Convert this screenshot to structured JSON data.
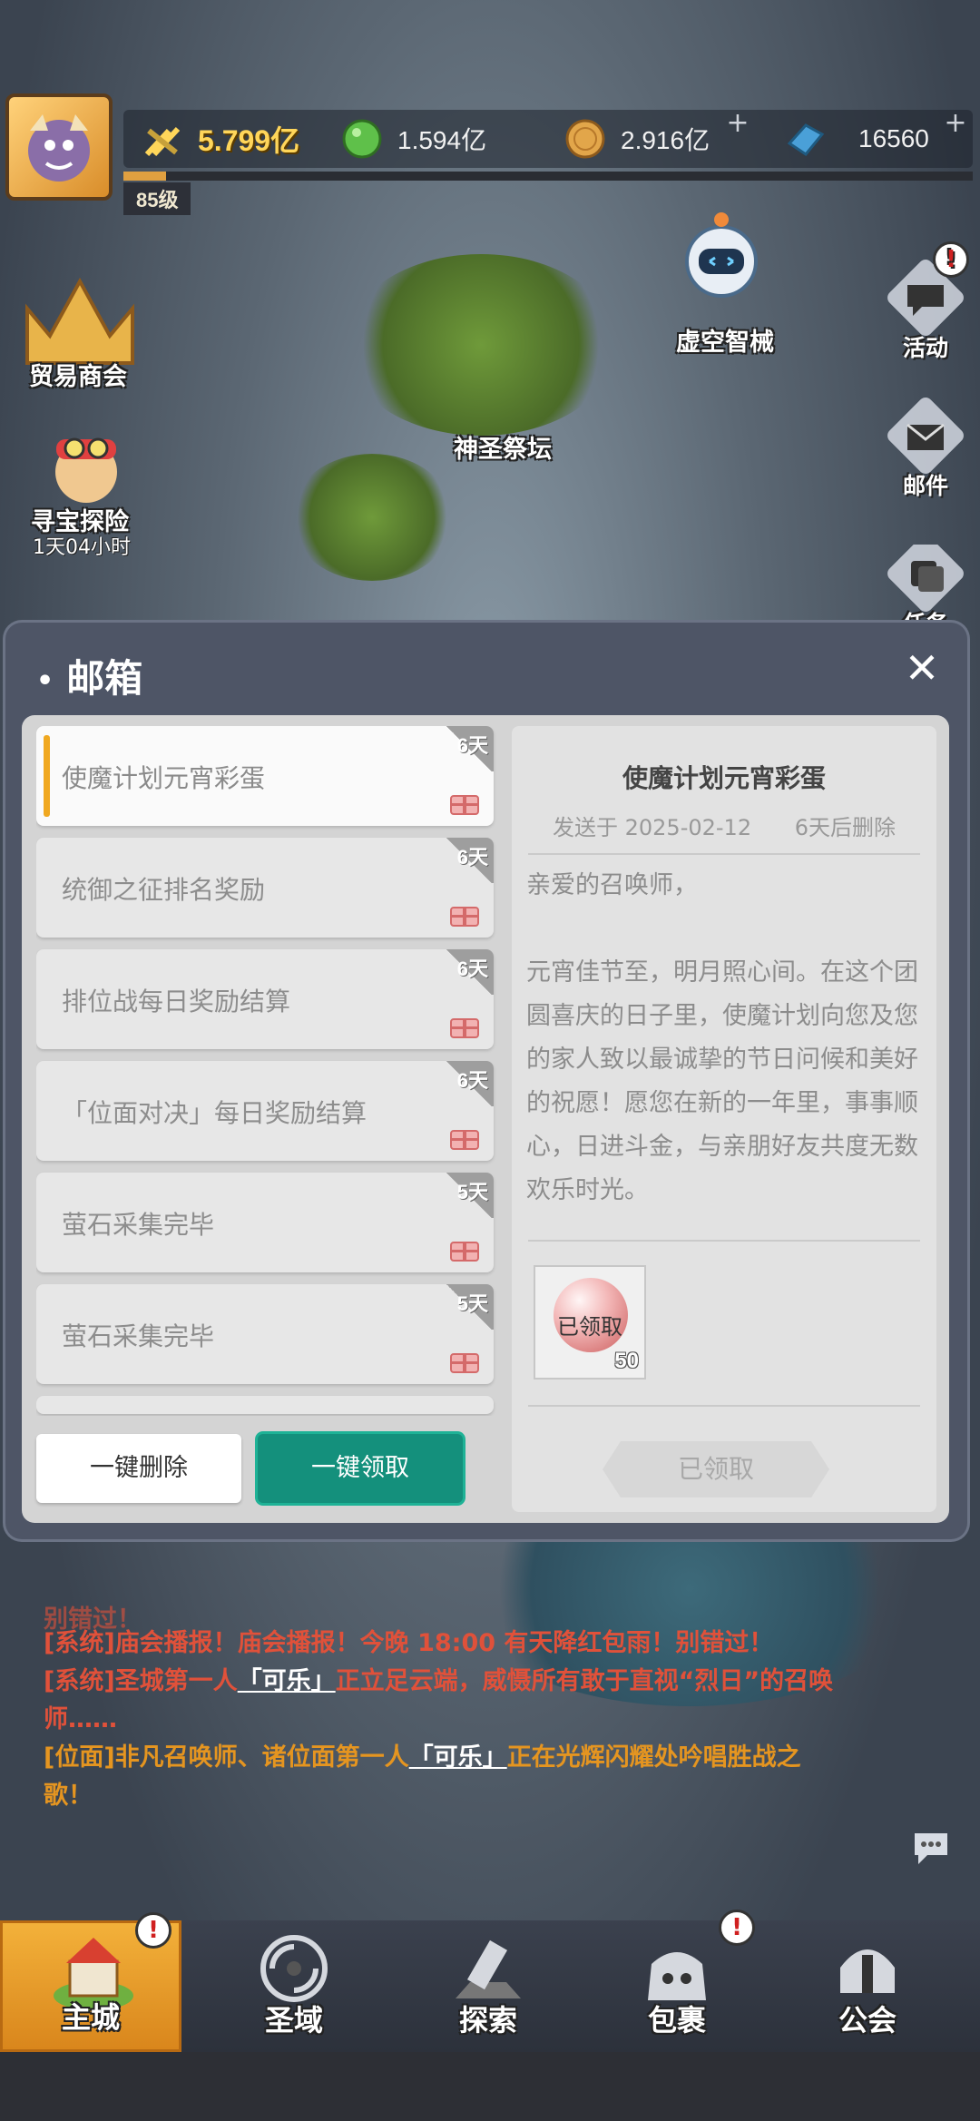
{
  "colors": {
    "accent_teal": "#14907c",
    "selected_marker": "#f0a820",
    "system_msg": "#e0513a",
    "position_msg": "#e59520",
    "power_gold": "#ffd65a",
    "badge_red": "#d02020"
  },
  "topbar": {
    "level": "85级",
    "xp_fraction": 0.05,
    "resources": [
      {
        "name": "power-icon",
        "value": "5.799亿"
      },
      {
        "name": "green-gem-icon",
        "value": "1.594亿"
      },
      {
        "name": "gold-coin-icon",
        "value": "2.916亿"
      },
      {
        "name": "blue-crystal-icon",
        "value": "16560"
      }
    ]
  },
  "map": {
    "trade_guild": "贸易商会",
    "treasure_hunt": "寻宝探险",
    "treasure_timer": "1天04小时",
    "void_machine": "虚空智械",
    "sacred_altar": "神圣祭坛"
  },
  "side_menu": {
    "activity": "活动",
    "mail": "邮件",
    "tasks": "任务"
  },
  "mailbox": {
    "title": "邮箱",
    "close": "✕",
    "mails": [
      {
        "title": "使魔计划元宵彩蛋",
        "days": "6天",
        "selected": true
      },
      {
        "title": "统御之征排名奖励",
        "days": "6天"
      },
      {
        "title": "排位战每日奖励结算",
        "days": "6天"
      },
      {
        "title": "「位面对决」每日奖励结算",
        "days": "6天"
      },
      {
        "title": "萤石采集完毕",
        "days": "5天"
      },
      {
        "title": "萤石采集完毕",
        "days": "5天"
      }
    ],
    "delete_all": "一键删除",
    "claim_all": "一键领取",
    "detail": {
      "title": "使魔计划元宵彩蛋",
      "sent": "发送于 2025-02-12",
      "expires": "6天后删除",
      "greeting": "亲爱的召唤师，",
      "body": "元宵佳节至，明月照心间。在这个团圆喜庆的日子里，使魔计划向您及您的家人致以最诚挚的节日问候和美好的祝愿！愿您在新的一年里，事事顺心，日进斗金，与亲朋好友共度无数欢乐时光。",
      "reward_label": "已领取",
      "reward_qty": "50",
      "claim_state": "已领取"
    }
  },
  "chat": {
    "faded_line": "别错过！",
    "messages": [
      {
        "type": "sys",
        "prefix": "[系统]",
        "text": "庙会播报！庙会播报！今晚 18:00 有天降红包雨！别错过！"
      },
      {
        "type": "sys",
        "prefix": "[系统]",
        "pre": "圣城第一人",
        "name": "「可乐」",
        "post": "正立足云端，威慑所有敢于直视“烈日”的召唤师……"
      },
      {
        "type": "pos",
        "prefix": "[位面]",
        "pre": "非凡召唤师、诸位面第一人",
        "name": "「可乐」",
        "post": "正在光辉闪耀处吟唱胜战之歌！"
      }
    ]
  },
  "bottom_nav": [
    {
      "label": "主城",
      "active": true,
      "badge": "!"
    },
    {
      "label": "圣域"
    },
    {
      "label": "探索"
    },
    {
      "label": "包裹",
      "badge": "!"
    },
    {
      "label": "公会"
    }
  ]
}
